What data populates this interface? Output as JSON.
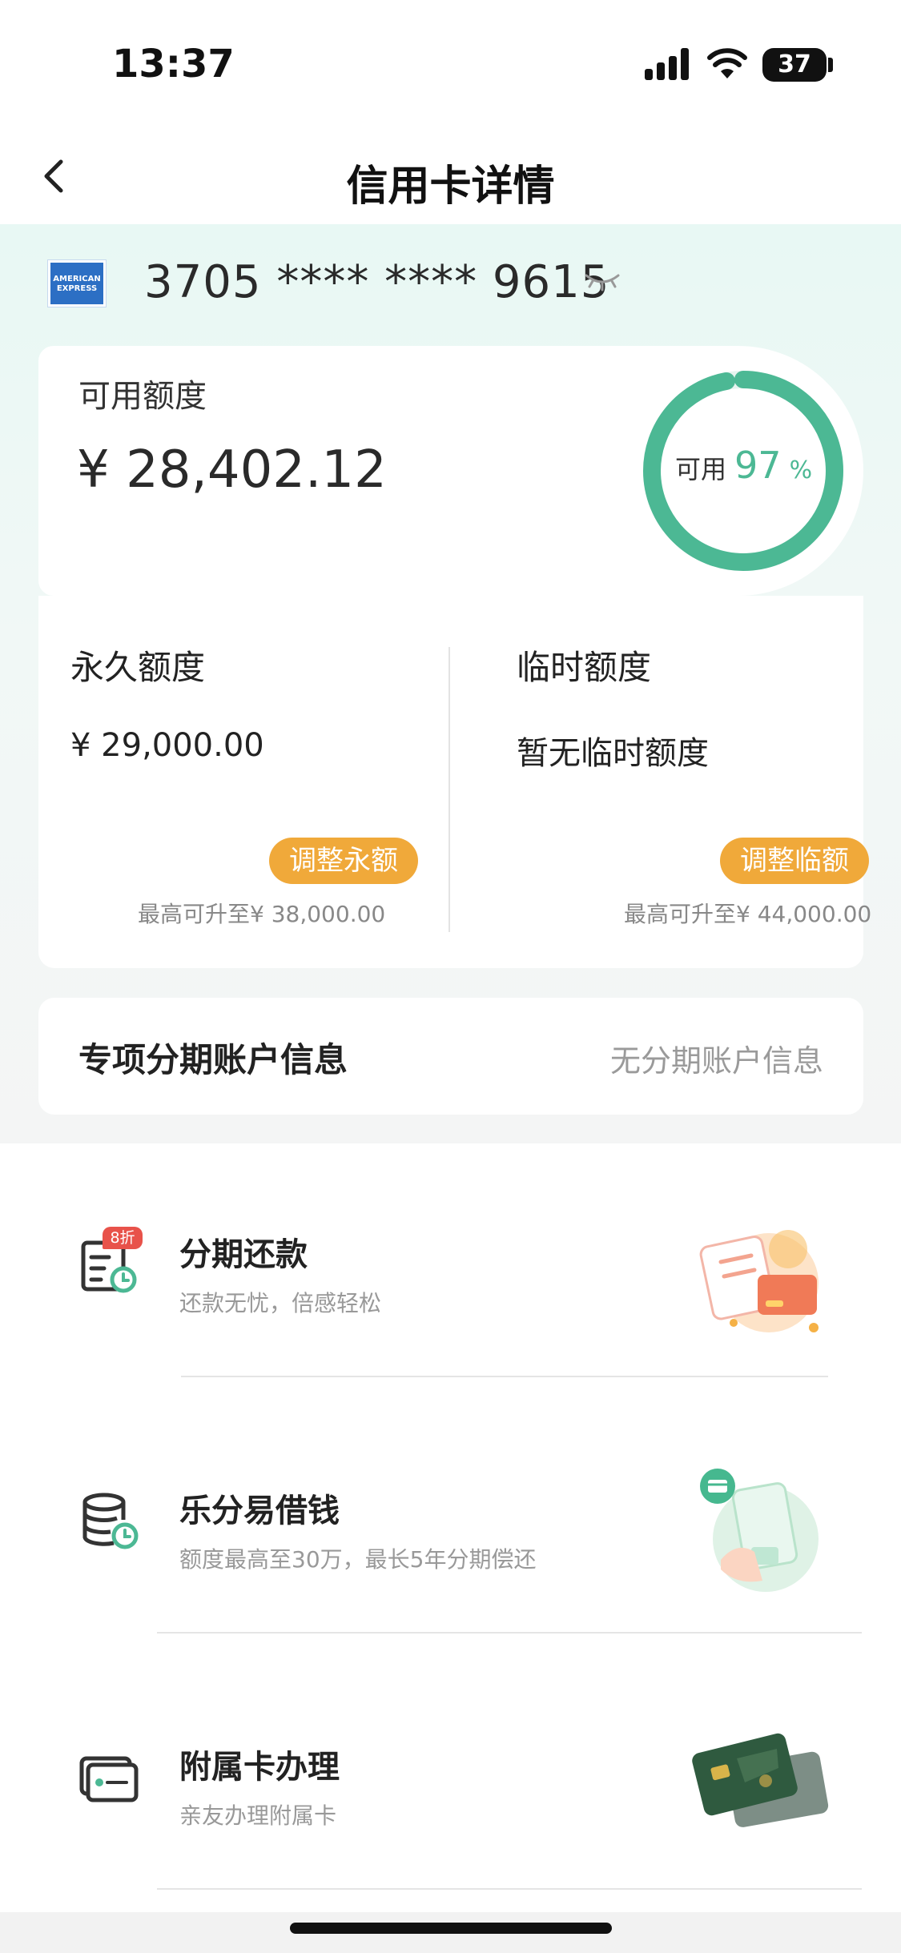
{
  "status_bar": {
    "time": "13:37",
    "battery": "37"
  },
  "nav": {
    "title": "信用卡详情"
  },
  "card": {
    "number": "3705 **** **** 9615",
    "logo_text_1": "AMERICAN",
    "logo_text_2": "EXPRESS"
  },
  "available": {
    "label": "可用额度",
    "amount": "¥ 28,402.12",
    "ring_label": "可用",
    "percent_text": "97",
    "percent_unit": "%",
    "percent_value": 97
  },
  "limits": {
    "permanent": {
      "title": "永久额度",
      "value": "¥ 29,000.00",
      "button": "调整永额",
      "hint": "最高可升至¥ 38,000.00"
    },
    "temporary": {
      "title": "临时额度",
      "value": "暂无临时额度",
      "button": "调整临额",
      "hint": "最高可升至¥ 44,000.00"
    }
  },
  "installment_account": {
    "title": "专项分期账户信息",
    "value": "无分期账户信息"
  },
  "services": [
    {
      "title": "分期还款",
      "subtitle": "还款无忧，倍感轻松",
      "icon": "installment-calendar-icon",
      "badge": "8折"
    },
    {
      "title": "乐分易借钱",
      "subtitle": "额度最高至30万，最长5年分期偿还",
      "icon": "coin-stack-clock-icon"
    },
    {
      "title": "附属卡办理",
      "subtitle": "亲友办理附属卡",
      "icon": "card-icon"
    }
  ],
  "colors": {
    "accent_green": "#4cb894",
    "button_orange": "#f0a93a",
    "amex_blue": "#2c6fc4"
  }
}
